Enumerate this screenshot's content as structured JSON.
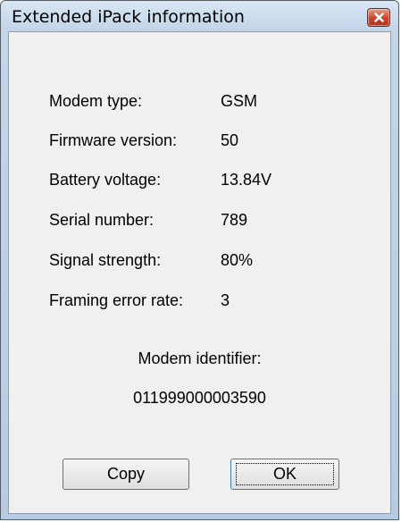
{
  "window": {
    "title": "Extended iPack information"
  },
  "icons": {
    "close": "close-icon"
  },
  "info": {
    "rows": [
      {
        "label": "Modem type:",
        "value": "GSM"
      },
      {
        "label": "Firmware version:",
        "value": "50"
      },
      {
        "label": "Battery voltage:",
        "value": "13.84V"
      },
      {
        "label": "Serial number:",
        "value": "789"
      },
      {
        "label": "Signal strength:",
        "value": "80%"
      },
      {
        "label": "Framing error rate:",
        "value": "3"
      }
    ],
    "identifier_label": "Modem identifier:",
    "identifier_value": "011999000003590"
  },
  "buttons": {
    "copy": "Copy",
    "ok": "OK"
  },
  "colors": {
    "frame": "#c4d6ea",
    "client": "#f0f0f0",
    "close_button": "#c8452c",
    "default_button_border": "#3c7fb1"
  }
}
